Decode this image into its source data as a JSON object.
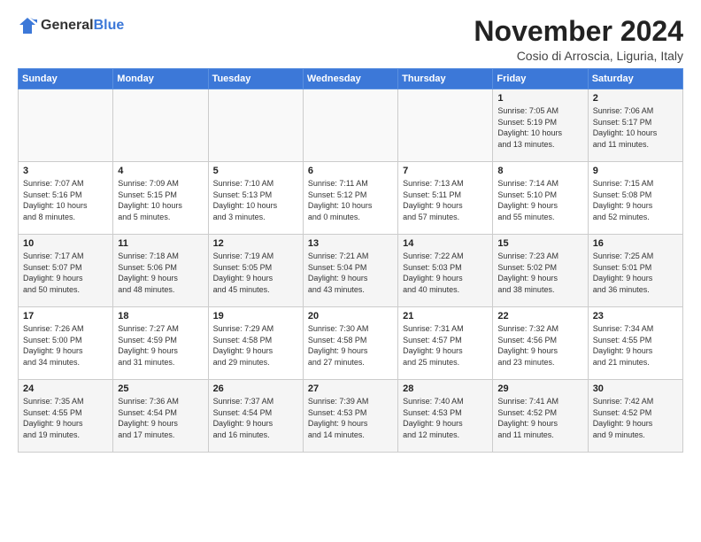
{
  "header": {
    "logo_general": "General",
    "logo_blue": "Blue",
    "title": "November 2024",
    "location": "Cosio di Arroscia, Liguria, Italy"
  },
  "weekdays": [
    "Sunday",
    "Monday",
    "Tuesday",
    "Wednesday",
    "Thursday",
    "Friday",
    "Saturday"
  ],
  "weeks": [
    [
      {
        "day": "",
        "info": ""
      },
      {
        "day": "",
        "info": ""
      },
      {
        "day": "",
        "info": ""
      },
      {
        "day": "",
        "info": ""
      },
      {
        "day": "",
        "info": ""
      },
      {
        "day": "1",
        "info": "Sunrise: 7:05 AM\nSunset: 5:19 PM\nDaylight: 10 hours\nand 13 minutes."
      },
      {
        "day": "2",
        "info": "Sunrise: 7:06 AM\nSunset: 5:17 PM\nDaylight: 10 hours\nand 11 minutes."
      }
    ],
    [
      {
        "day": "3",
        "info": "Sunrise: 7:07 AM\nSunset: 5:16 PM\nDaylight: 10 hours\nand 8 minutes."
      },
      {
        "day": "4",
        "info": "Sunrise: 7:09 AM\nSunset: 5:15 PM\nDaylight: 10 hours\nand 5 minutes."
      },
      {
        "day": "5",
        "info": "Sunrise: 7:10 AM\nSunset: 5:13 PM\nDaylight: 10 hours\nand 3 minutes."
      },
      {
        "day": "6",
        "info": "Sunrise: 7:11 AM\nSunset: 5:12 PM\nDaylight: 10 hours\nand 0 minutes."
      },
      {
        "day": "7",
        "info": "Sunrise: 7:13 AM\nSunset: 5:11 PM\nDaylight: 9 hours\nand 57 minutes."
      },
      {
        "day": "8",
        "info": "Sunrise: 7:14 AM\nSunset: 5:10 PM\nDaylight: 9 hours\nand 55 minutes."
      },
      {
        "day": "9",
        "info": "Sunrise: 7:15 AM\nSunset: 5:08 PM\nDaylight: 9 hours\nand 52 minutes."
      }
    ],
    [
      {
        "day": "10",
        "info": "Sunrise: 7:17 AM\nSunset: 5:07 PM\nDaylight: 9 hours\nand 50 minutes."
      },
      {
        "day": "11",
        "info": "Sunrise: 7:18 AM\nSunset: 5:06 PM\nDaylight: 9 hours\nand 48 minutes."
      },
      {
        "day": "12",
        "info": "Sunrise: 7:19 AM\nSunset: 5:05 PM\nDaylight: 9 hours\nand 45 minutes."
      },
      {
        "day": "13",
        "info": "Sunrise: 7:21 AM\nSunset: 5:04 PM\nDaylight: 9 hours\nand 43 minutes."
      },
      {
        "day": "14",
        "info": "Sunrise: 7:22 AM\nSunset: 5:03 PM\nDaylight: 9 hours\nand 40 minutes."
      },
      {
        "day": "15",
        "info": "Sunrise: 7:23 AM\nSunset: 5:02 PM\nDaylight: 9 hours\nand 38 minutes."
      },
      {
        "day": "16",
        "info": "Sunrise: 7:25 AM\nSunset: 5:01 PM\nDaylight: 9 hours\nand 36 minutes."
      }
    ],
    [
      {
        "day": "17",
        "info": "Sunrise: 7:26 AM\nSunset: 5:00 PM\nDaylight: 9 hours\nand 34 minutes."
      },
      {
        "day": "18",
        "info": "Sunrise: 7:27 AM\nSunset: 4:59 PM\nDaylight: 9 hours\nand 31 minutes."
      },
      {
        "day": "19",
        "info": "Sunrise: 7:29 AM\nSunset: 4:58 PM\nDaylight: 9 hours\nand 29 minutes."
      },
      {
        "day": "20",
        "info": "Sunrise: 7:30 AM\nSunset: 4:58 PM\nDaylight: 9 hours\nand 27 minutes."
      },
      {
        "day": "21",
        "info": "Sunrise: 7:31 AM\nSunset: 4:57 PM\nDaylight: 9 hours\nand 25 minutes."
      },
      {
        "day": "22",
        "info": "Sunrise: 7:32 AM\nSunset: 4:56 PM\nDaylight: 9 hours\nand 23 minutes."
      },
      {
        "day": "23",
        "info": "Sunrise: 7:34 AM\nSunset: 4:55 PM\nDaylight: 9 hours\nand 21 minutes."
      }
    ],
    [
      {
        "day": "24",
        "info": "Sunrise: 7:35 AM\nSunset: 4:55 PM\nDaylight: 9 hours\nand 19 minutes."
      },
      {
        "day": "25",
        "info": "Sunrise: 7:36 AM\nSunset: 4:54 PM\nDaylight: 9 hours\nand 17 minutes."
      },
      {
        "day": "26",
        "info": "Sunrise: 7:37 AM\nSunset: 4:54 PM\nDaylight: 9 hours\nand 16 minutes."
      },
      {
        "day": "27",
        "info": "Sunrise: 7:39 AM\nSunset: 4:53 PM\nDaylight: 9 hours\nand 14 minutes."
      },
      {
        "day": "28",
        "info": "Sunrise: 7:40 AM\nSunset: 4:53 PM\nDaylight: 9 hours\nand 12 minutes."
      },
      {
        "day": "29",
        "info": "Sunrise: 7:41 AM\nSunset: 4:52 PM\nDaylight: 9 hours\nand 11 minutes."
      },
      {
        "day": "30",
        "info": "Sunrise: 7:42 AM\nSunset: 4:52 PM\nDaylight: 9 hours\nand 9 minutes."
      }
    ]
  ]
}
